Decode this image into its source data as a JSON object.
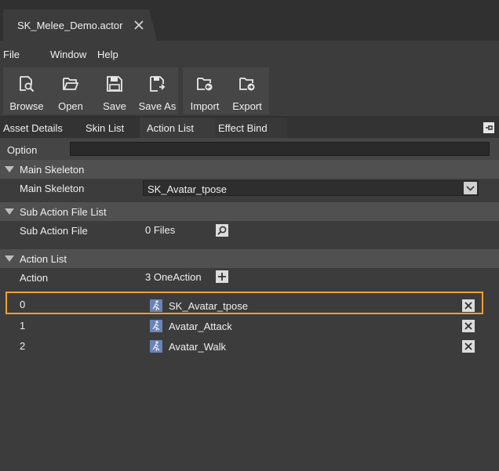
{
  "document_tab": {
    "title": "SK_Melee_Demo.actor"
  },
  "menu": [
    "File",
    "Window",
    "Help"
  ],
  "toolbar": {
    "browse": "Browse",
    "open": "Open",
    "save": "Save",
    "save_as": "Save As",
    "import": "Import",
    "export": "Export"
  },
  "panel_tabs": [
    "Asset Details",
    "Skin List",
    "Action List",
    "Effect Bind"
  ],
  "option": {
    "label": "Option",
    "value": ""
  },
  "main_skeleton": {
    "header": "Main Skeleton",
    "label": "Main Skeleton",
    "value": "SK_Avatar_tpose"
  },
  "sub_action": {
    "header": "Sub Action File List",
    "label": "Sub Action File",
    "count": "0 Files"
  },
  "action_list": {
    "header": "Action List",
    "label": "Action",
    "count": "3 OneAction",
    "items": [
      {
        "index": "0",
        "name": "SK_Avatar_tpose"
      },
      {
        "index": "1",
        "name": "Avatar_Attack"
      },
      {
        "index": "2",
        "name": "Avatar_Walk"
      }
    ]
  },
  "colors": {
    "background": "#303030",
    "panel": "#3c3c3c",
    "section_header": "#505050",
    "highlight": "#f0a030"
  }
}
